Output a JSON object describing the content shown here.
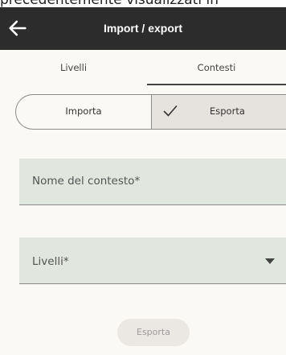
{
  "caption_fragment": "precedentemente visualizzati in",
  "appbar": {
    "title": "Import / export",
    "back_icon": "arrow-left-icon"
  },
  "tabs": [
    {
      "label": "Livelli"
    },
    {
      "label": "Contesti"
    }
  ],
  "active_tab": "Contesti",
  "segmented": {
    "import_label": "Importa",
    "export_label": "Esporta",
    "selected": "Esporta",
    "check_icon": "check-icon"
  },
  "form": {
    "context_name_label": "Nome del contesto*",
    "levels_label": "Livelli*",
    "levels_dropdown_icon": "caret-down-icon"
  },
  "submit": {
    "label": "Esporta",
    "enabled": false
  },
  "colors": {
    "appbar": "#2c2c2c",
    "background": "#fbf9f5",
    "field": "#e1e6de",
    "selected_segment": "#e6e3de"
  }
}
